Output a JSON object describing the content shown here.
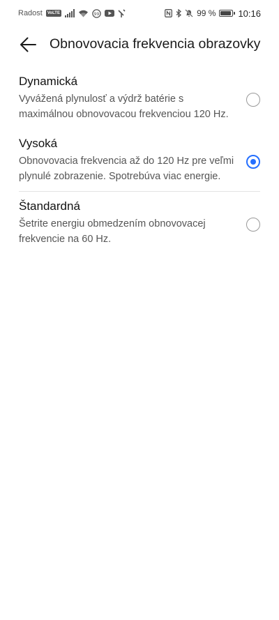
{
  "status_bar": {
    "carrier": "Radost",
    "volte": "VoLTE",
    "battery_percent": "99 %",
    "battery_level": 0.99,
    "time": "10:16",
    "left_icons": [
      "signal-icon",
      "wifi-icon",
      "data-saver-icon",
      "youtube-icon",
      "antenna-icon"
    ],
    "right_icons": [
      "nfc-icon",
      "bluetooth-icon",
      "mute-icon",
      "battery-icon"
    ]
  },
  "header": {
    "title": "Obnovovacia frekvencia obrazovky",
    "back_icon": "back-arrow-icon"
  },
  "options": [
    {
      "title": "Dynamická",
      "description": "Vyvážená plynulosť a výdrž batérie s maximálnou obnovovacou frekvenciou 120 Hz.",
      "selected": false
    },
    {
      "title": "Vysoká",
      "description": "Obnovovacia frekvencia až do 120 Hz pre veľmi plynulé zobrazenie. Spotrebúva viac energie.",
      "selected": true
    },
    {
      "title": "Štandardná",
      "description": "Šetrite energiu obmedzením obnovovacej frekvencie na 60 Hz.",
      "selected": false
    }
  ],
  "colors": {
    "accent": "#256FFF",
    "text_primary": "#111111",
    "text_secondary": "#555555",
    "divider": "#e3e3e3"
  }
}
